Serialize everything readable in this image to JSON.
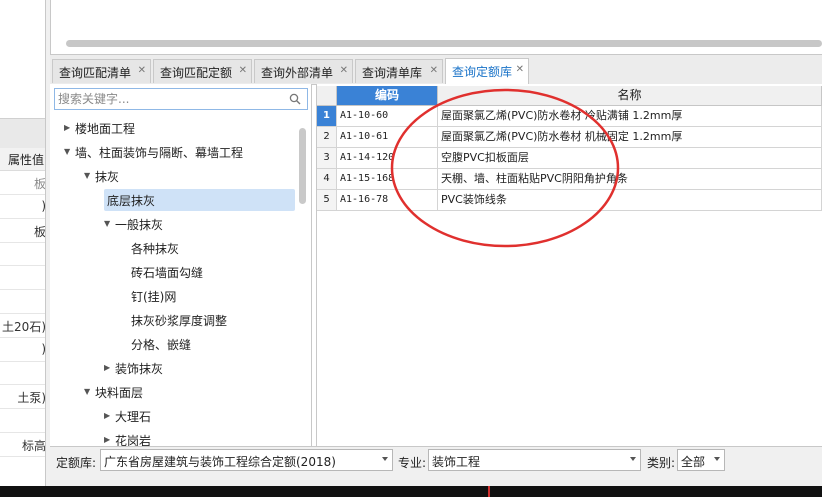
{
  "left_panel": {
    "header": "属性值",
    "rows": [
      {
        "text": "板",
        "muted": true
      },
      {
        "text": ")",
        "muted": false
      },
      {
        "text": "板",
        "muted": false
      },
      {
        "text": "",
        "muted": false
      },
      {
        "text": "",
        "muted": false
      },
      {
        "text": "",
        "muted": false
      },
      {
        "text": "土20石)",
        "muted": false
      },
      {
        "text": ")",
        "muted": false
      },
      {
        "text": "",
        "muted": false
      },
      {
        "text": "土泵)",
        "muted": false
      },
      {
        "text": "",
        "muted": false
      },
      {
        "text": "标高",
        "muted": false
      }
    ]
  },
  "tabs": [
    {
      "label": "查询匹配清单",
      "active": false
    },
    {
      "label": "查询匹配定额",
      "active": false
    },
    {
      "label": "查询外部清单",
      "active": false
    },
    {
      "label": "查询清单库",
      "active": false
    },
    {
      "label": "查询定额库",
      "active": true
    }
  ],
  "search": {
    "placeholder": "搜索关键字..."
  },
  "tree": [
    {
      "label": "楼地面工程",
      "level": 0,
      "state": "collapsed"
    },
    {
      "label": "墙、柱面装饰与隔断、幕墙工程",
      "level": 0,
      "state": "expanded"
    },
    {
      "label": "抹灰",
      "level": 1,
      "state": "expanded"
    },
    {
      "label": "底层抹灰",
      "level": 2,
      "state": "leaf",
      "selected": true
    },
    {
      "label": "一般抹灰",
      "level": 2,
      "state": "expanded"
    },
    {
      "label": "各种抹灰",
      "level": 3,
      "state": "leaf"
    },
    {
      "label": "砖石墙面勾缝",
      "level": 3,
      "state": "leaf"
    },
    {
      "label": "钉(挂)网",
      "level": 3,
      "state": "leaf"
    },
    {
      "label": "抹灰砂浆厚度调整",
      "level": 3,
      "state": "leaf"
    },
    {
      "label": "分格、嵌缝",
      "level": 3,
      "state": "leaf"
    },
    {
      "label": "装饰抹灰",
      "level": 2,
      "state": "collapsed"
    },
    {
      "label": "块料面层",
      "level": 1,
      "state": "expanded"
    },
    {
      "label": "大理石",
      "level": 2,
      "state": "collapsed"
    },
    {
      "label": "花岗岩",
      "level": 2,
      "state": "collapsed"
    }
  ],
  "grid": {
    "columns": {
      "code": "编码",
      "name": "名称"
    },
    "rows": [
      {
        "num": "1",
        "code": "A1-10-60",
        "name": "屋面聚氯乙烯(PVC)防水卷材 冷贴满铺 1.2mm厚"
      },
      {
        "num": "2",
        "code": "A1-10-61",
        "name": "屋面聚氯乙烯(PVC)防水卷材 机械固定 1.2mm厚"
      },
      {
        "num": "3",
        "code": "A1-14-120",
        "name": "空腹PVC扣板面层"
      },
      {
        "num": "4",
        "code": "A1-15-168",
        "name": "天棚、墙、柱面粘贴PVC阴阳角护角条"
      },
      {
        "num": "5",
        "code": "A1-16-78",
        "name": "PVC装饰线条"
      }
    ],
    "active_row": 0,
    "annotation_color": "#e0302e"
  },
  "filters": {
    "quota_lib_label": "定额库:",
    "quota_lib_value": "广东省房屋建筑与装饰工程综合定额(2018)",
    "major_label": "专业:",
    "major_value": "装饰工程",
    "category_label": "类别:",
    "category_value": "全部"
  },
  "colors": {
    "accent": "#1a73c8",
    "row_header_active": "#3a82d6",
    "selection": "#cfe2f7"
  }
}
